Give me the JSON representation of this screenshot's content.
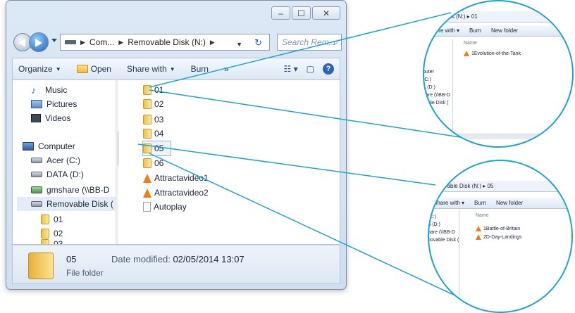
{
  "explorer": {
    "address": {
      "crumbs": [
        "Com...",
        "Removable Disk (N:)"
      ],
      "search_placeholder": "Search Rem..."
    },
    "toolbar": {
      "organize": "Organize",
      "open": "Open",
      "share_with": "Share with",
      "burn": "Burn",
      "more": "»"
    },
    "nav_items": {
      "music": "Music",
      "pictures": "Pictures",
      "videos": "Videos",
      "computer": "Computer",
      "acer": "Acer (C:)",
      "data": "DATA (D:)",
      "gmshare": "gmshare (\\\\BB-D",
      "removable": "Removable Disk (",
      "sub01": "01",
      "sub02": "02",
      "sub03": "03"
    },
    "files": {
      "f01": "01",
      "f02": "02",
      "f03": "03",
      "f04": "04",
      "f05": "05",
      "f06": "06",
      "video1": "Attractavideo1",
      "video2": "Attractavideo2",
      "autoplay": "Autoplay"
    },
    "status": {
      "name": "05",
      "type": "File folder",
      "date_label": "Date modified:",
      "date_value": "02/05/2014 13:07"
    }
  },
  "zoom_top": {
    "address": "vable Disk (N:)  ▸  01",
    "share_with": "Share with ▾",
    "burn": "Burn",
    "new_folder": "New folder",
    "nav": [
      "s",
      "",
      "",
      "puter",
      "(C:)",
      "A (D:)",
      "hare (\\\\BB-D",
      "vable Disk ("
    ],
    "column_name": "Name",
    "file": "1Evolution-of-the-Tank"
  },
  "zoom_bottom": {
    "address": "emovable Disk (N:)  ▸  05",
    "share_with": "Share with ▾",
    "burn": "Burn",
    "new_folder": "New folder",
    "nav": [
      "(C:)",
      "A (D:)",
      "hare (\\\\BB-D",
      "novable Disk ("
    ],
    "column_name": "Name",
    "files": [
      "1Battle-of-Britain",
      "2D-Day-Landings"
    ]
  },
  "colors": {
    "accent_line": "#1aa3d8",
    "window_frame": "#cfdfef"
  }
}
